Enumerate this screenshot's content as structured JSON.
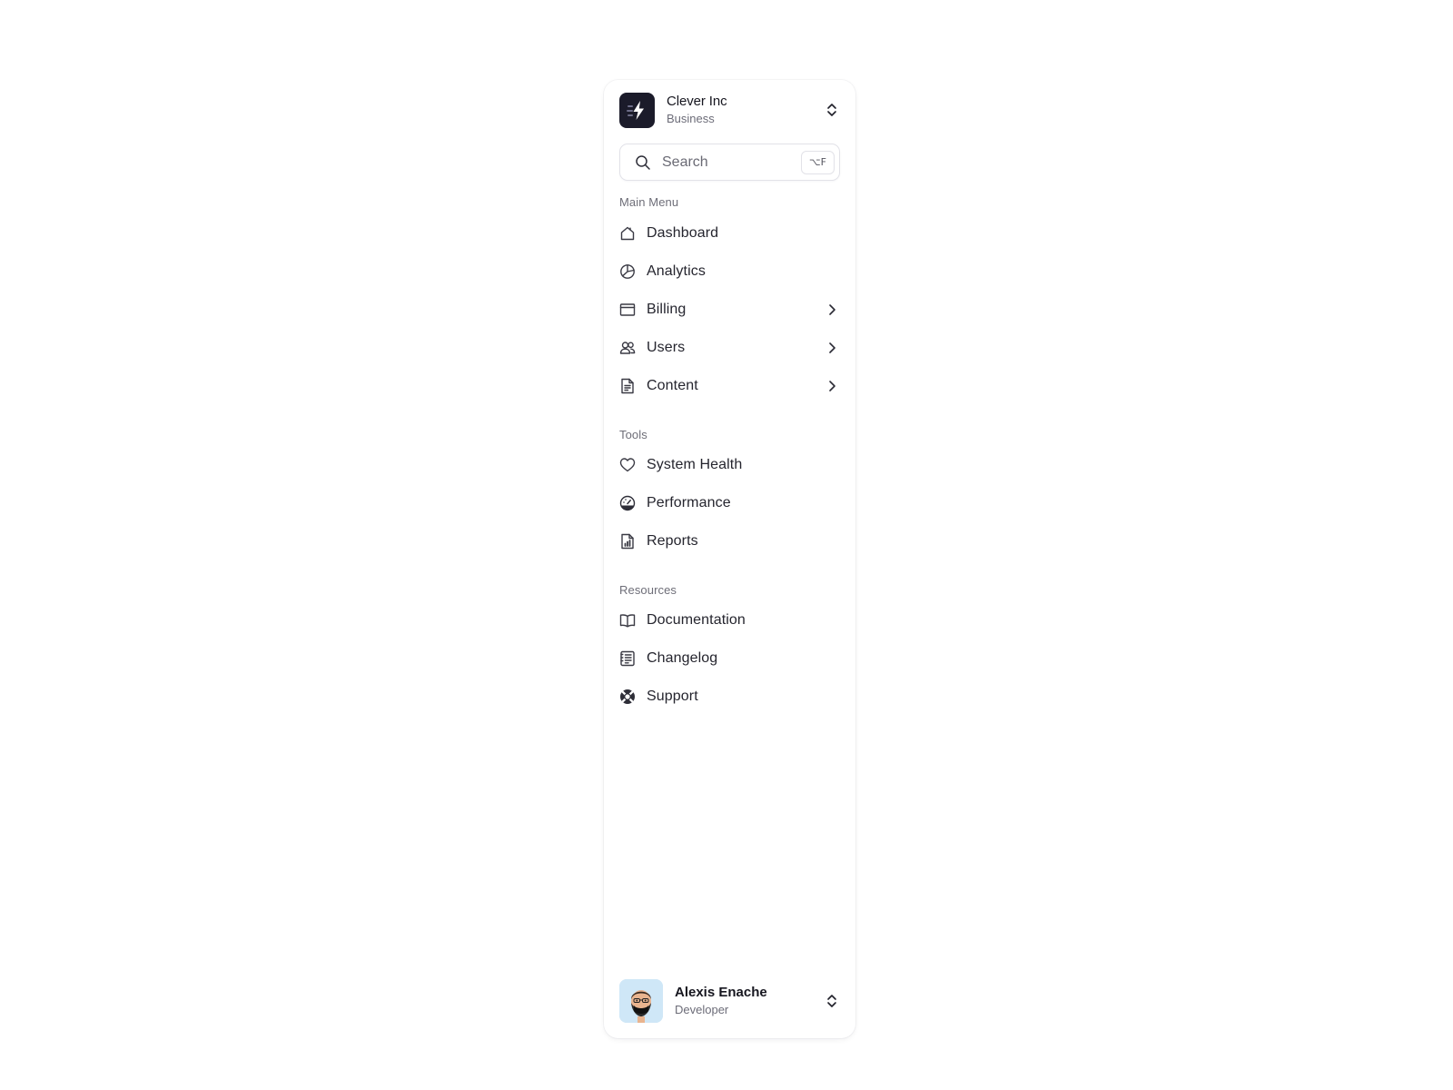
{
  "org": {
    "name": "Clever Inc",
    "plan": "Business"
  },
  "search": {
    "placeholder": "Search",
    "shortcut": "⌥F"
  },
  "sections": {
    "main_menu": "Main Menu",
    "tools": "Tools",
    "resources": "Resources"
  },
  "main_menu": {
    "dashboard": "Dashboard",
    "analytics": "Analytics",
    "billing": "Billing",
    "users": "Users",
    "content": "Content"
  },
  "tools": {
    "system_health": "System Health",
    "performance": "Performance",
    "reports": "Reports"
  },
  "resources": {
    "documentation": "Documentation",
    "changelog": "Changelog",
    "support": "Support"
  },
  "user": {
    "name": "Alexis Enache",
    "role": "Developer"
  },
  "icons": {
    "org_logo": "bolt-icon",
    "org_switcher": "chevron-up-down-icon",
    "search": "search-icon",
    "dashboard": "home-icon",
    "analytics": "pie-chart-icon",
    "billing": "credit-card-icon",
    "users": "users-icon",
    "content": "document-icon",
    "system_health": "heart-icon",
    "performance": "gauge-icon",
    "reports": "report-icon",
    "documentation": "book-icon",
    "changelog": "changelog-icon",
    "support": "lifebuoy-icon",
    "expand": "chevron-right-icon",
    "user_switcher": "chevron-up-down-icon"
  },
  "colors": {
    "logo_bg": "#1b1b2a",
    "avatar_bg": "#cfe7f7",
    "text_primary": "#25252e",
    "text_muted": "#6e6e78",
    "border": "#e2e2e8"
  }
}
